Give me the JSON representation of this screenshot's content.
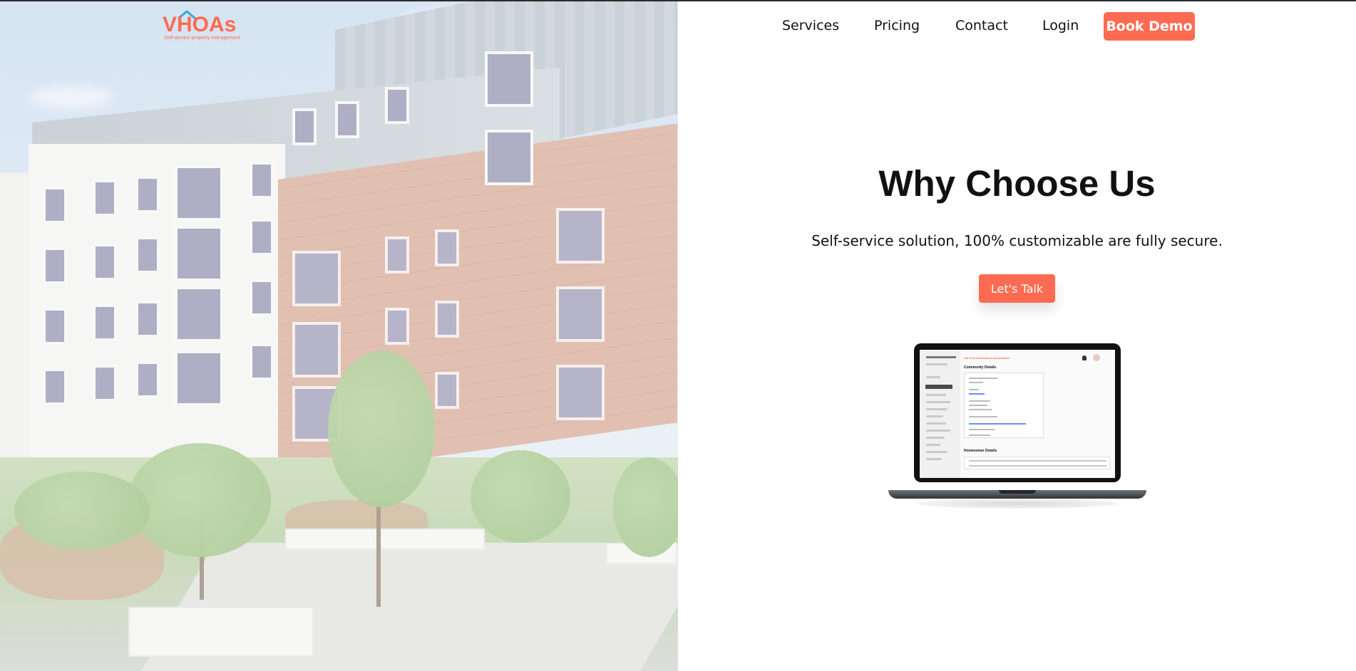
{
  "brand": {
    "name": "VHOAs",
    "tagline": "Self-service property management",
    "accent": "#ff6b4f"
  },
  "nav": {
    "items": [
      {
        "label": "Services"
      },
      {
        "label": "Pricing"
      },
      {
        "label": "Contact"
      },
      {
        "label": "Login"
      }
    ],
    "cta_label": "Book Demo"
  },
  "hero": {
    "image_icon": "apartment-building-image",
    "headline": "Why Choose Us",
    "subheadline": "Self-service solution, 100% customizable are fully secure.",
    "cta_label": "Let's Talk"
  },
  "laptop_screen": {
    "icon": "laptop-icon",
    "app_title": "Cal Tech Homeowner Association",
    "section1_title": "Community Details",
    "section2_title": "Homeowner Details"
  }
}
